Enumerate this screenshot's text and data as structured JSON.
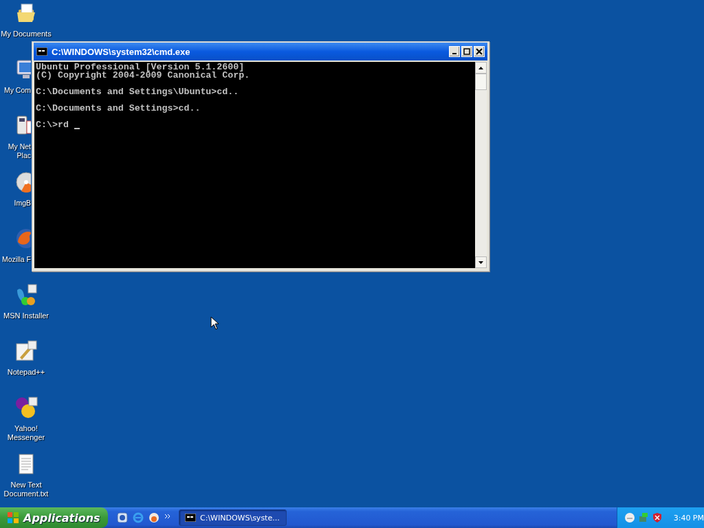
{
  "desktop_icons": [
    {
      "label_lines": [
        "My Documents"
      ],
      "kind": "full"
    },
    {
      "label_lines": [
        "My Com"
      ],
      "kind": "partial"
    },
    {
      "label_lines": [
        "My Net",
        "Plac"
      ],
      "kind": "partial"
    },
    {
      "label_lines": [
        "ImgB"
      ],
      "kind": "partial"
    },
    {
      "label_lines": [
        "Mozilla F"
      ],
      "kind": "partial"
    },
    {
      "label_lines": [
        "MSN Installer"
      ],
      "kind": "full"
    },
    {
      "label_lines": [
        "Notepad++"
      ],
      "kind": "full"
    },
    {
      "label_lines": [
        "Yahoo!",
        "Messenger"
      ],
      "kind": "full"
    },
    {
      "label_lines": [
        "New Text",
        "Document.txt"
      ],
      "kind": "full"
    }
  ],
  "window": {
    "title": "C:\\WINDOWS\\system32\\cmd.exe",
    "console_blocks": [
      [
        "Ubuntu Professional [Version 5.1.2600]",
        "(C) Copyright 2004-2009 Canonical Corp."
      ],
      [
        "C:\\Documents and Settings\\Ubuntu>cd.."
      ],
      [
        "C:\\Documents and Settings>cd.."
      ],
      [
        "C:\\>rd"
      ]
    ]
  },
  "taskbar": {
    "start_label": "Applications",
    "tasks": [
      {
        "label": "C:\\WINDOWS\\syste...",
        "selected": true
      }
    ],
    "clock": "3:40 PM"
  }
}
